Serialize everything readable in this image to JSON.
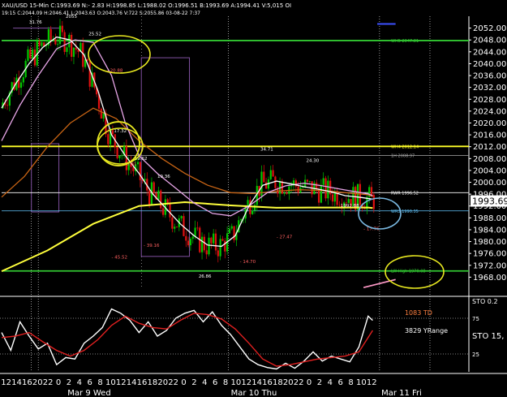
{
  "header": {
    "symbol": "XAU/USD",
    "timeframe": "15-Min",
    "stats": "C:1993.69  N:- 2.83  H:1998.85  L:1988.02  O:1996.51  B:1993.69  A:1994.41  V:5,015  OI",
    "line2": "19:15  C:2044.09  H:2046.41  L:2043.63  O:2043.76  V:722  S:2055.86  03-08-22  7:37"
  },
  "colors": {
    "background": "#000000",
    "up_candle": "#00c800",
    "down_candle": "#e01010",
    "sma_yellow": "#ffff3c",
    "sma_white": "#ffffff",
    "sma_pink": "#e8a6e8",
    "sma_orange": "#c86414",
    "level_green": "#32c832",
    "level_yellow": "#ffff28",
    "level_cyan": "#64c8ff",
    "oscillator_white": "#ffffff",
    "oscillator_red": "#e02020"
  },
  "chart_data": [
    {
      "type": "line",
      "panel": "price",
      "ylim": [
        1964,
        2056
      ],
      "y_ticks": [
        2052,
        2048,
        2044,
        2040,
        2036,
        2032,
        2028,
        2024,
        2020,
        2016,
        2012,
        2008,
        2004,
        2000,
        1996,
        1992,
        1988,
        1984,
        1980,
        1976,
        1972,
        1968
      ],
      "y_tick_labels": [
        "2052.00",
        "2048.00",
        "2044.00",
        "2040.00",
        "2036.00",
        "2032.00",
        "2028.00",
        "2024.00",
        "2020.00",
        "2016.00",
        "2012.00",
        "2008.00",
        "2004.00",
        "2000.00",
        "1996.00",
        "1992.00",
        "1988.00",
        "1984.00",
        "1980.00",
        "1976.00",
        "1972.00",
        "1968.00"
      ],
      "last_price_label": "1993.69",
      "x_tick_labels": [
        "12",
        "14",
        "16",
        "20",
        "22",
        "0",
        "2",
        "4",
        "6",
        "8",
        "10",
        "12",
        "14",
        "16",
        "18",
        "20",
        "22",
        "0",
        "2",
        "4",
        "6",
        "8",
        "10",
        "12",
        "14",
        "16",
        "18",
        "20",
        "22",
        "0",
        "2",
        "4",
        "6",
        "8",
        "10",
        "12"
      ],
      "x_date_labels": [
        "Mar 9 Wed",
        "Mar 10 Thu",
        "Mar 11 Fri"
      ],
      "levels": [
        {
          "label": "WH5 2047.81",
          "value": 2047.8,
          "color": "#32c832"
        },
        {
          "label": "WH4 2012.14",
          "value": 2012.1,
          "color": "#ffff28"
        },
        {
          "label": "1H 2008.97",
          "value": 2009.0,
          "color": "#aaaaaa"
        },
        {
          "label": "RWR 1996.52",
          "value": 1996.5,
          "color": "#ffffff"
        },
        {
          "label": "WR3 1990.35",
          "value": 1990.35,
          "color": "#64c8ff"
        },
        {
          "label": "LW High 1970.08",
          "value": 1970.1,
          "color": "#32c832"
        }
      ],
      "swing_labels": [
        {
          "text": "2055",
          "x": 28,
          "y": 2055.5
        },
        {
          "text": "31.76",
          "x": 12,
          "y": 2053.6
        },
        {
          "text": "25.52",
          "x": 38,
          "y": 2049.5
        },
        {
          "text": "- 20.88",
          "x": 46,
          "y": 2037.2
        },
        {
          "text": "17.32",
          "x": 49,
          "y": 2016.9
        },
        {
          "text": "- 43.81",
          "x": 52,
          "y": 2005.8
        },
        {
          "text": "19.62",
          "x": 58,
          "y": 2007.6
        },
        {
          "text": "19.36",
          "x": 68,
          "y": 2001.5
        },
        {
          "text": "- 39.16",
          "x": 62,
          "y": 1978.3
        },
        {
          "text": "- 45.52",
          "x": 48,
          "y": 1974.3
        },
        {
          "text": "26.86",
          "x": 86,
          "y": 1967.8
        },
        {
          "text": "- 14.70",
          "x": 104,
          "y": 1972.8
        },
        {
          "text": "34.71",
          "x": 113,
          "y": 2010.7
        },
        {
          "text": "24.30",
          "x": 133,
          "y": 2006.9
        },
        {
          "text": "- 27.47",
          "x": 120,
          "y": 1981.1
        },
        {
          "text": "1992.88",
          "x": 148,
          "y": 1991.7
        },
        {
          "text": "- 17.76",
          "x": 158,
          "y": 1983.9
        }
      ],
      "series": [
        {
          "name": "",
          "color": "#ffff3c",
          "x": [
            0,
            20,
            40,
            60,
            80,
            100,
            120,
            140,
            160,
            162
          ],
          "y": [
            1970.0,
            1977.0,
            1986.0,
            1992.0,
            1993.3,
            1992.2,
            1991.4,
            1991.5,
            1991.5,
            1991.3
          ]
        },
        {
          "name": "",
          "color": "#c86414",
          "x": [
            0,
            10,
            20,
            30,
            40,
            50,
            60,
            70,
            80,
            90,
            100,
            110,
            120,
            130,
            140,
            150,
            160,
            162
          ],
          "y": [
            1995.0,
            2002.0,
            2012.0,
            2020.0,
            2025.0,
            2021.5,
            2014.0,
            2008.0,
            2003.0,
            1999.0,
            1996.5,
            1996.2,
            1997.0,
            1997.5,
            1997.2,
            1996.5,
            1995.8,
            1995.2
          ]
        },
        {
          "name": "",
          "color": "#e8a6e8",
          "x": [
            0,
            8,
            16,
            24,
            32,
            40,
            48,
            54,
            60,
            68,
            76,
            84,
            92,
            100,
            108,
            116,
            124,
            132,
            140,
            150,
            160,
            162
          ],
          "y": [
            2014.0,
            2026.0,
            2036.0,
            2045.0,
            2048.0,
            2047.2,
            2036.0,
            2020.0,
            2009.0,
            2003.0,
            1998.0,
            1993.0,
            1989.5,
            1988.7,
            1992.0,
            1996.5,
            1998.8,
            1999.7,
            1998.8,
            1997.4,
            1996.1,
            1995.5
          ]
        },
        {
          "name": "",
          "color": "#ffffff",
          "x": [
            0,
            6,
            12,
            18,
            24,
            30,
            36,
            42,
            48,
            54,
            60,
            66,
            72,
            78,
            84,
            90,
            96,
            102,
            108,
            114,
            120,
            126,
            132,
            138,
            144,
            150,
            156,
            162
          ],
          "y": [
            2025.0,
            2033.0,
            2040.0,
            2045.5,
            2049.0,
            2048.0,
            2043.0,
            2031.0,
            2016.0,
            2009.0,
            2003.0,
            1996.0,
            1991.0,
            1986.0,
            1982.0,
            1978.8,
            1978.4,
            1982.0,
            1992.0,
            1999.0,
            2000.4,
            1999.5,
            1998.5,
            1997.7,
            1996.8,
            1995.5,
            1995.0,
            1994.3
          ]
        }
      ]
    },
    {
      "type": "line",
      "panel": "oscillator",
      "ylim": [
        0,
        100
      ],
      "y_ticks": [
        25,
        50,
        75
      ],
      "y_tick_labels": [
        "25",
        "STO 15,",
        "75"
      ],
      "top_label": "STO 0.2",
      "annotations": [
        "1083 TD",
        "3829 YRange"
      ],
      "series": [
        {
          "name": "",
          "color": "#ffffff",
          "x": [
            0,
            4,
            8,
            12,
            16,
            20,
            24,
            28,
            32,
            36,
            40,
            44,
            48,
            52,
            56,
            60,
            64,
            68,
            72,
            76,
            80,
            84,
            88,
            92,
            96,
            100,
            104,
            108,
            112,
            116,
            120,
            124,
            128,
            132,
            136,
            140,
            144,
            148,
            152,
            156,
            160,
            162
          ],
          "y": [
            55,
            30,
            70,
            50,
            32,
            40,
            10,
            20,
            18,
            40,
            50,
            62,
            88,
            82,
            72,
            55,
            70,
            50,
            58,
            75,
            82,
            86,
            70,
            84,
            65,
            52,
            35,
            18,
            10,
            6,
            4,
            12,
            5,
            15,
            28,
            15,
            22,
            18,
            14,
            35,
            78,
            72
          ]
        },
        {
          "name": "",
          "color": "#e02020",
          "x": [
            0,
            6,
            12,
            18,
            24,
            30,
            36,
            42,
            48,
            54,
            60,
            66,
            72,
            78,
            84,
            90,
            96,
            102,
            108,
            114,
            120,
            126,
            132,
            138,
            144,
            150,
            156,
            162
          ],
          "y": [
            48,
            50,
            55,
            42,
            30,
            22,
            30,
            45,
            65,
            78,
            68,
            62,
            60,
            72,
            82,
            80,
            74,
            60,
            40,
            18,
            8,
            10,
            14,
            18,
            20,
            22,
            28,
            58
          ]
        }
      ]
    }
  ]
}
